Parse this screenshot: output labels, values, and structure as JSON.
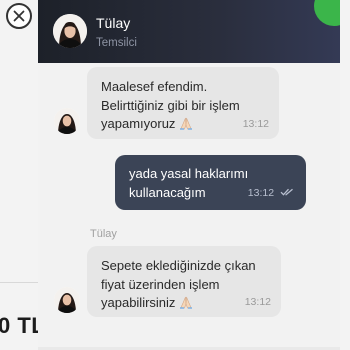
{
  "background": {
    "price_fragment": "0 TL"
  },
  "chat": {
    "agent": {
      "name": "Tülay",
      "role": "Temsilci"
    },
    "messages": [
      {
        "id": "m1",
        "direction": "incoming",
        "text": "Maalesef efendim.\nBelirttiğiniz gibi bir işlem\nyapamıyoruz",
        "emoji": "folded-hands",
        "time": "13:12"
      },
      {
        "id": "m2",
        "direction": "outgoing",
        "text": "yada yasal haklarımı\nkullanacağım",
        "time": "13:12",
        "status": "read"
      },
      {
        "id": "m3",
        "direction": "incoming",
        "sender_label": "Tülay",
        "text": "Sepete eklediğinizde çıkan\nfiyat üzerinden işlem\nyapabilirsiniz",
        "emoji": "folded-hands",
        "time": "13:12"
      }
    ]
  },
  "colors": {
    "header_bg": "#1d2129",
    "accent_green": "#3bb54a",
    "incoming_bubble": "#e6e6e6",
    "outgoing_bubble": "#3b4456"
  },
  "icons": {
    "close": "close-icon",
    "read_receipt": "double-check-icon",
    "emoji": "folded-hands-icon"
  }
}
